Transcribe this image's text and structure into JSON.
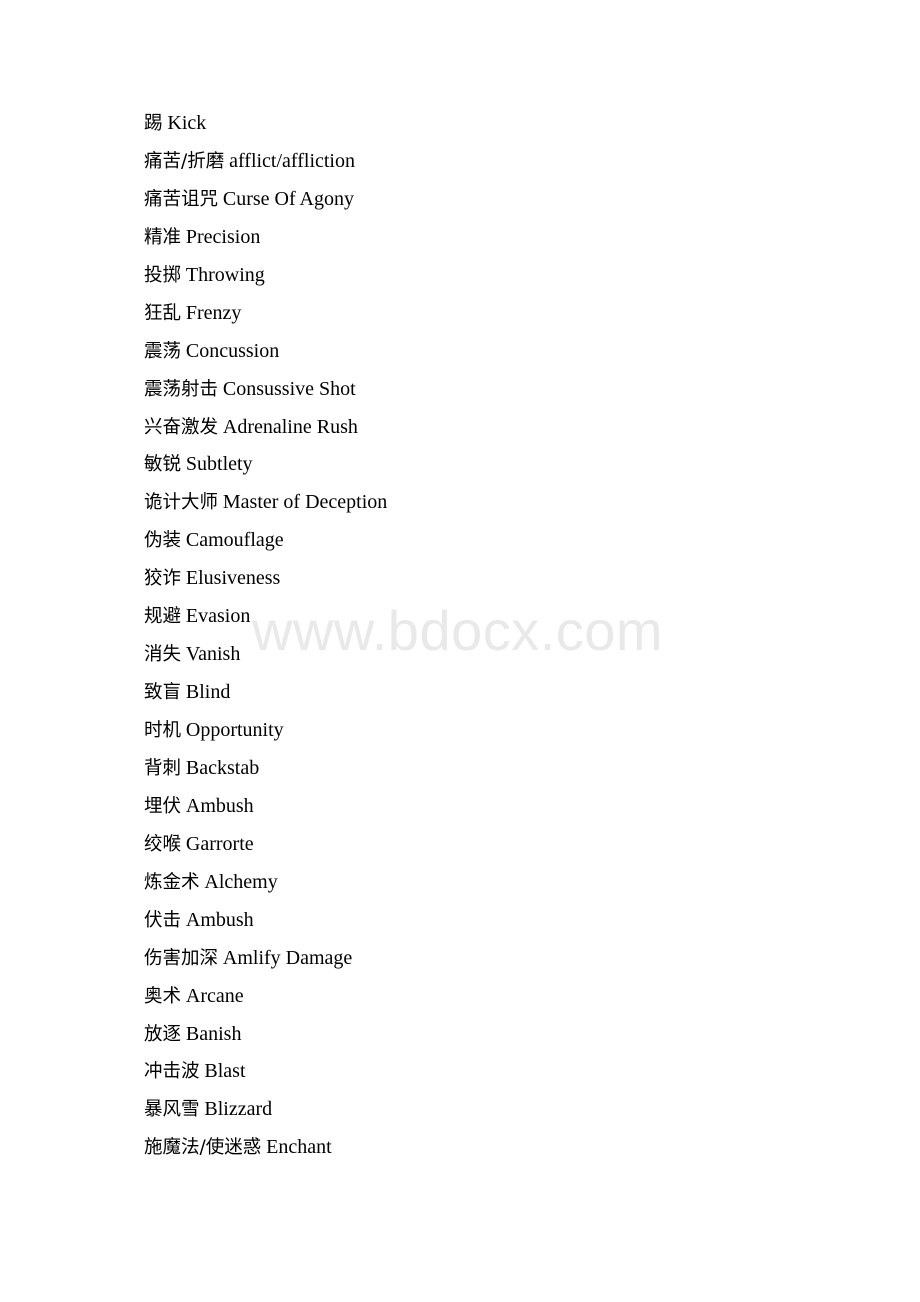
{
  "document": {
    "watermark": "www.bdocx.com",
    "entries": [
      {
        "cjk": "踢",
        "latin": "Kick"
      },
      {
        "cjk": "痛苦/折磨",
        "latin": "afflict/affliction"
      },
      {
        "cjk": "痛苦诅咒",
        "latin": "Curse Of Agony"
      },
      {
        "cjk": "精准",
        "latin": "Precision"
      },
      {
        "cjk": "投掷",
        "latin": "Throwing"
      },
      {
        "cjk": "狂乱",
        "latin": "Frenzy"
      },
      {
        "cjk": "震荡",
        "latin": "Concussion"
      },
      {
        "cjk": "震荡射击",
        "latin": "Consussive Shot"
      },
      {
        "cjk": "兴奋激发",
        "latin": "Adrenaline Rush"
      },
      {
        "cjk": "敏锐",
        "latin": "Subtlety"
      },
      {
        "cjk": "诡计大师",
        "latin": "Master of Deception"
      },
      {
        "cjk": "伪装",
        "latin": "Camouflage"
      },
      {
        "cjk": "狡诈",
        "latin": "Elusiveness"
      },
      {
        "cjk": "规避",
        "latin": "Evasion"
      },
      {
        "cjk": "消失",
        "latin": "Vanish"
      },
      {
        "cjk": "致盲",
        "latin": "Blind"
      },
      {
        "cjk": "时机",
        "latin": "Opportunity"
      },
      {
        "cjk": "背刺",
        "latin": "Backstab"
      },
      {
        "cjk": "埋伏",
        "latin": "Ambush"
      },
      {
        "cjk": "绞喉",
        "latin": "Garrorte"
      },
      {
        "cjk": "炼金术",
        "latin": "Alchemy"
      },
      {
        "cjk": "伏击",
        "latin": "Ambush"
      },
      {
        "cjk": "伤害加深",
        "latin": "Amlify Damage"
      },
      {
        "cjk": "奥术",
        "latin": "Arcane"
      },
      {
        "cjk": "放逐",
        "latin": "Banish"
      },
      {
        "cjk": "冲击波",
        "latin": "Blast"
      },
      {
        "cjk": "暴风雪",
        "latin": "Blizzard"
      },
      {
        "cjk": "施魔法/使迷惑",
        "latin": "Enchant"
      }
    ]
  }
}
